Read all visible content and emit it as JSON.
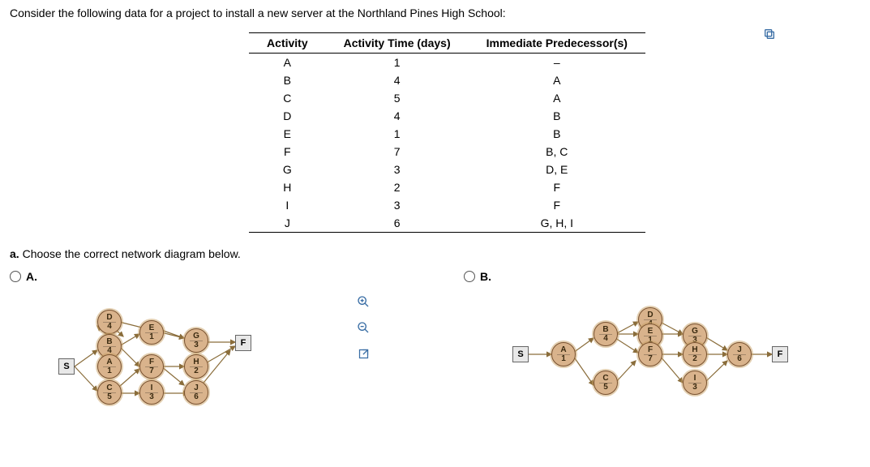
{
  "prompt": "Consider the following data for a project to install a new server at the Northland Pines High School:",
  "table": {
    "headers": [
      "Activity",
      "Activity Time (days)",
      "Immediate Predecessor(s)"
    ],
    "rows": [
      {
        "act": "A",
        "time": "1",
        "pred": "–"
      },
      {
        "act": "B",
        "time": "4",
        "pred": "A"
      },
      {
        "act": "C",
        "time": "5",
        "pred": "A"
      },
      {
        "act": "D",
        "time": "4",
        "pred": "B"
      },
      {
        "act": "E",
        "time": "1",
        "pred": "B"
      },
      {
        "act": "F",
        "time": "7",
        "pred": "B, C"
      },
      {
        "act": "G",
        "time": "3",
        "pred": "D, E"
      },
      {
        "act": "H",
        "time": "2",
        "pred": "F"
      },
      {
        "act": "I",
        "time": "3",
        "pred": "F"
      },
      {
        "act": "J",
        "time": "6",
        "pred": "G, H, I"
      }
    ]
  },
  "subq": {
    "label": "a.",
    "text": " Choose the correct network diagram below."
  },
  "options": {
    "A": {
      "label": "A.",
      "start": "S",
      "end": "F",
      "nodes": {
        "A": {
          "v": "1"
        },
        "B": {
          "v": "4"
        },
        "C": {
          "v": "5"
        },
        "D": {
          "v": "4"
        },
        "E": {
          "v": "1"
        },
        "F": {
          "v": "7"
        },
        "G": {
          "v": "3"
        },
        "H": {
          "v": "2"
        },
        "I": {
          "v": "3"
        },
        "J": {
          "v": "6"
        }
      }
    },
    "B": {
      "label": "B.",
      "start": "S",
      "end": "F",
      "nodes": {
        "A": {
          "v": "1"
        },
        "B": {
          "v": "4"
        },
        "C": {
          "v": "5"
        },
        "D": {
          "v": "4"
        },
        "E": {
          "v": "1"
        },
        "F": {
          "v": "7"
        },
        "G": {
          "v": "3"
        },
        "H": {
          "v": "2"
        },
        "I": {
          "v": "3"
        },
        "J": {
          "v": "6"
        }
      }
    }
  },
  "tools": {
    "zoom_in": "zoom-in",
    "zoom_out": "zoom-out",
    "popout": "popout"
  }
}
